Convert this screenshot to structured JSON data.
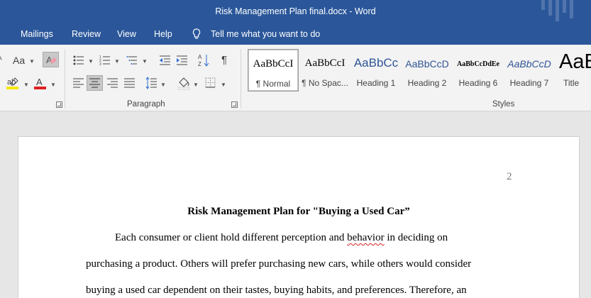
{
  "window": {
    "title": "Risk Management Plan final.docx  -  Word"
  },
  "menu": {
    "items": [
      "Mailings",
      "Review",
      "View",
      "Help"
    ],
    "tell_me": "Tell me what you want to do"
  },
  "ribbon": {
    "font_group": {
      "change_case_label": "Aa",
      "clear_format_label": "A"
    },
    "paragraph_group": {
      "label": "Paragraph"
    },
    "styles_group": {
      "label": "Styles",
      "items": [
        {
          "sample": "AaBbCcI",
          "name": "¶ Normal",
          "selected": true
        },
        {
          "sample": "AaBbCcI",
          "name": "¶ No Spac..."
        },
        {
          "sample": "AaBbCc",
          "name": "Heading 1"
        },
        {
          "sample": "AaBbCcD",
          "name": "Heading 2"
        },
        {
          "sample": "AaBbCcDdEe",
          "name": "Heading 6"
        },
        {
          "sample": "AaBbCcD",
          "name": "Heading 7"
        },
        {
          "sample": "AaB",
          "name": "Title"
        }
      ]
    },
    "colors": {
      "highlight": "#f5e600",
      "font_color": "#e02020"
    }
  },
  "document": {
    "page_number": "2",
    "heading": "Risk Management Plan for \"Buying a Used Car”",
    "line1_a": "Each consumer or client hold different perception and ",
    "line1_err": "behavior",
    "line1_b": " in deciding on",
    "line2": "purchasing a product. Others will prefer purchasing new cars, while others would consider",
    "line3": "buying a used car dependent on their tastes, buying habits, and preferences. Therefore, an"
  }
}
